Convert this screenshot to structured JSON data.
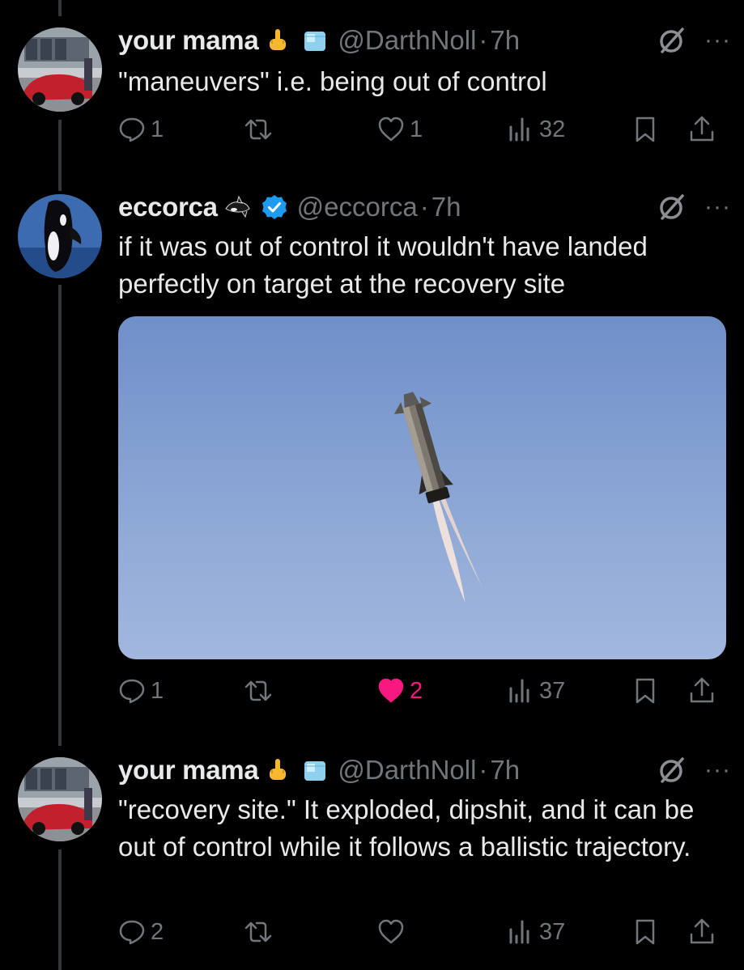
{
  "tweets": [
    {
      "name": "your mama",
      "handle": "@DarthNoll",
      "time": "7h",
      "text": "\"maneuvers\" i.e. being out of control",
      "replies": "1",
      "likes": "1",
      "views": "32"
    },
    {
      "name": "eccorca",
      "handle": "@eccorca",
      "time": "7h",
      "text": "if it was out of control it wouldn't have landed perfectly on target at the recovery site",
      "replies": "1",
      "likes": "2",
      "views": "37",
      "liked_color": "#f91880",
      "verified_color": "#1d9bf0"
    },
    {
      "name": "your mama",
      "handle": "@DarthNoll",
      "time": "7h",
      "text": "\"recovery site.\" It exploded, dipshit, and it can be out of control while it follows a ballistic trajectory.",
      "replies": "2",
      "likes": "",
      "views": "37"
    }
  ],
  "icons": {
    "middle_finger": "middle-finger-emoji",
    "ice": "ice-cube-emoji",
    "orca": "orca-emoji",
    "verified": "verified-badge-icon",
    "grok": "grok-icon",
    "more": "more-icon",
    "reply": "reply-icon",
    "retweet": "retweet-icon",
    "like": "heart-icon",
    "views": "views-icon",
    "bookmark": "bookmark-icon",
    "share": "share-icon"
  },
  "colors": {
    "background": "#000000",
    "text": "#e7e9ea",
    "secondary": "#71767b",
    "like": "#f91880",
    "verified": "#1d9bf0"
  }
}
